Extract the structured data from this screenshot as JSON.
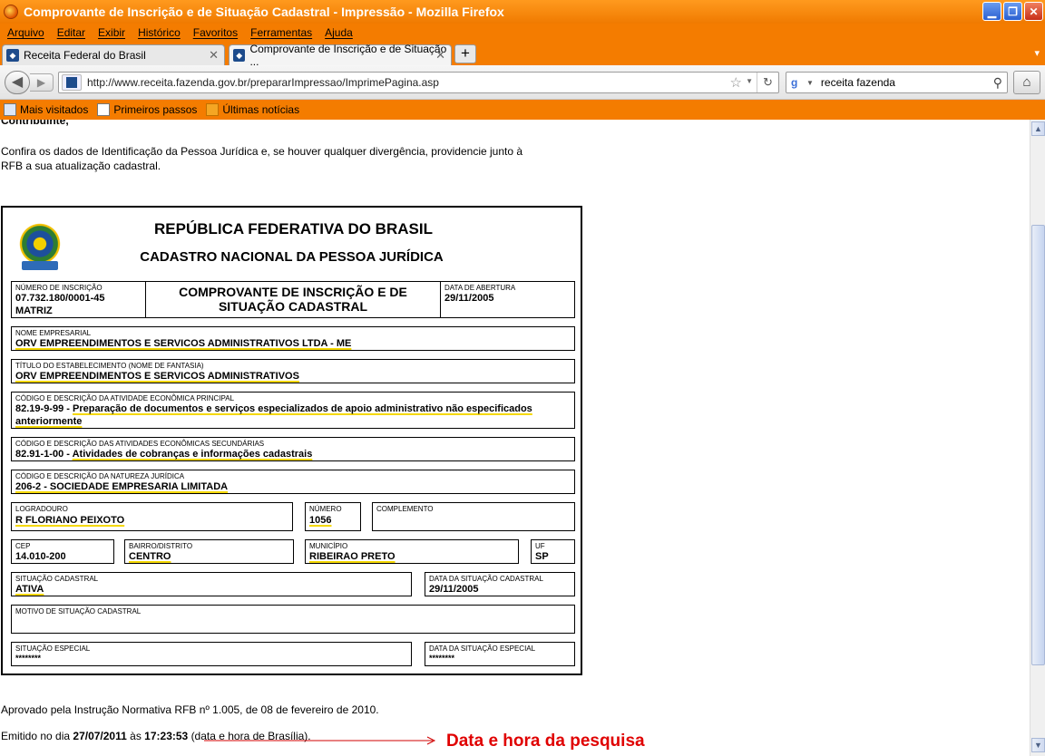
{
  "window": {
    "title": "Comprovante de Inscrição e de Situação Cadastral - Impressão - Mozilla Firefox"
  },
  "menu": [
    "Arquivo",
    "Editar",
    "Exibir",
    "Histórico",
    "Favoritos",
    "Ferramentas",
    "Ajuda"
  ],
  "tabs": [
    {
      "label": "Receita Federal do Brasil"
    },
    {
      "label": "Comprovante de Inscrição e de Situação ..."
    }
  ],
  "nav": {
    "url": "http://www.receita.fazenda.gov.br/prepararImpressao/ImprimePagina.asp",
    "search_value": "receita fazenda"
  },
  "bookmarks": [
    "Mais visitados",
    "Primeiros passos",
    "Últimas notícias"
  ],
  "page": {
    "intro_heading": "Contribuinte,",
    "intro_line1": "Confira os dados de Identificação da Pessoa Jurídica e, se houver qualquer divergência, providencie junto à",
    "intro_line2": "RFB a sua atualização cadastral.",
    "footer_text": "Aprovado pela Instrução Normativa RFB nº 1.005, de 08 de fevereiro de 2010.",
    "emitted_prefix": "Emitido no dia",
    "emitted_date": "27/07/2011",
    "emitted_at": "às",
    "emitted_time": "17:23:53",
    "emitted_suffix": "(data e hora de Brasília).",
    "annotation": "Data e hora da pesquisa"
  },
  "cert": {
    "title1": "REPÚBLICA FEDERATIVA DO BRASIL",
    "title2": "CADASTRO NACIONAL DA PESSOA JURÍDICA",
    "numero_label": "NÚMERO DE INSCRIÇÃO",
    "numero": "07.732.180/0001-45",
    "matriz": "MATRIZ",
    "comprovante": "COMPROVANTE DE INSCRIÇÃO E DE SITUAÇÃO CADASTRAL",
    "abertura_label": "DATA DE ABERTURA",
    "abertura": "29/11/2005",
    "nome_label": "NOME EMPRESARIAL",
    "nome": "ORV EMPREENDIMENTOS E SERVICOS ADMINISTRATIVOS LTDA - ME",
    "fantasia_label": "TÍTULO DO ESTABELECIMENTO (NOME DE FANTASIA)",
    "fantasia": "ORV EMPREENDIMENTOS E SERVICOS ADMINISTRATIVOS",
    "atividade_label": "CÓDIGO E DESCRIÇÃO DA ATIVIDADE ECONÔMICA PRINCIPAL",
    "atividade_code": "82.19-9-99 -",
    "atividade_desc1": "Preparação de documentos e serviços especializados de apoio administrativo não especificados",
    "atividade_desc2": "anteriormente",
    "secundarias_label": "CÓDIGO E DESCRIÇÃO DAS ATIVIDADES ECONÔMICAS SECUNDÁRIAS",
    "secundarias_code": "82.91-1-00 -",
    "secundarias_desc": "Atividades de cobranças e informações cadastrais",
    "natureza_label": "CÓDIGO E DESCRIÇÃO DA NATUREZA JURÍDICA",
    "natureza": "206-2 - SOCIEDADE EMPRESARIA LIMITADA",
    "logradouro_label": "LOGRADOURO",
    "logradouro": "R FLORIANO PEIXOTO",
    "numero_end_label": "NÚMERO",
    "numero_end": "1056",
    "complemento_label": "COMPLEMENTO",
    "cep_label": "CEP",
    "cep": "14.010-200",
    "bairro_label": "BAIRRO/DISTRITO",
    "bairro": "CENTRO",
    "municipio_label": "MUNICÍPIO",
    "municipio": "RIBEIRAO PRETO",
    "uf_label": "UF",
    "uf": "SP",
    "situacao_label": "SITUAÇÃO CADASTRAL",
    "situacao": "ATIVA",
    "data_situacao_label": "DATA DA SITUAÇÃO CADASTRAL",
    "data_situacao": "29/11/2005",
    "motivo_label": "MOTIVO DE SITUAÇÃO CADASTRAL",
    "especial_label": "SITUAÇÃO ESPECIAL",
    "especial": "********",
    "data_especial_label": "DATA DA SITUAÇÃO ESPECIAL",
    "data_especial": "********"
  }
}
